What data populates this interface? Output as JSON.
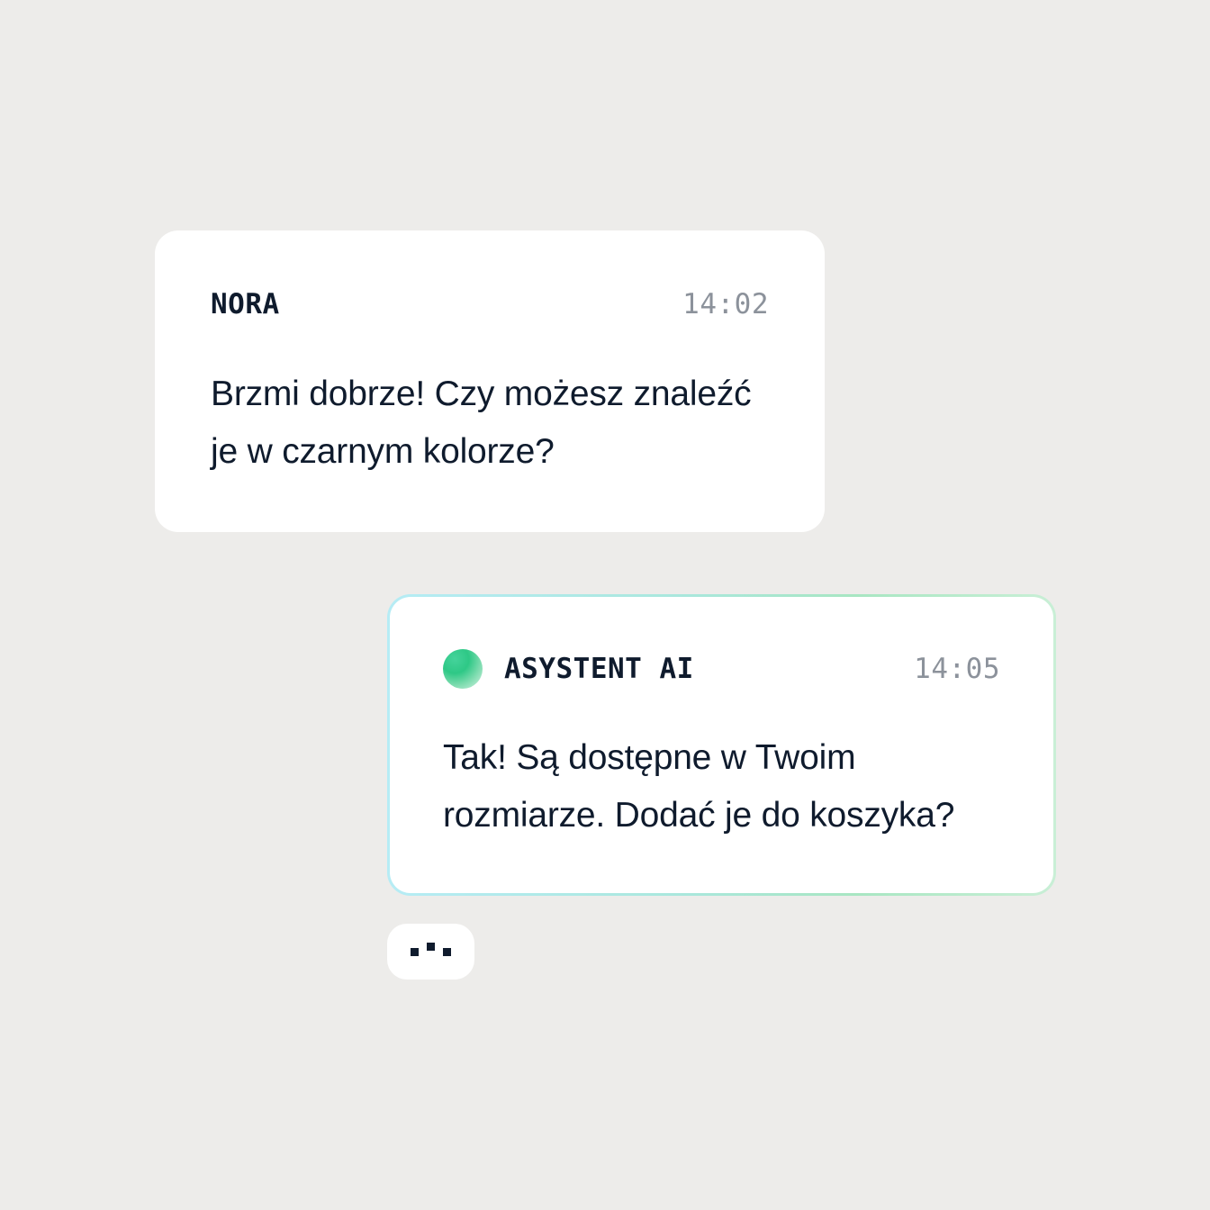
{
  "messages": [
    {
      "sender": "NORA",
      "time": "14:02",
      "text": "Brzmi dobrze! Czy możesz znaleźć je w czarnym kolorze?"
    },
    {
      "sender": "ASYSTENT AI",
      "time": "14:05",
      "text": "Tak! Są dostępne w Twoim rozmiarze. Dodać je do koszyka?"
    }
  ],
  "typing_indicator": {
    "icon": "typing-dots-icon"
  },
  "colors": {
    "background": "#edecea",
    "bubble": "#ffffff",
    "text": "#0f1b2d",
    "timestamp": "#8c929b",
    "ai_accent": "#2ec886",
    "ai_border": "#a9e7dc"
  }
}
